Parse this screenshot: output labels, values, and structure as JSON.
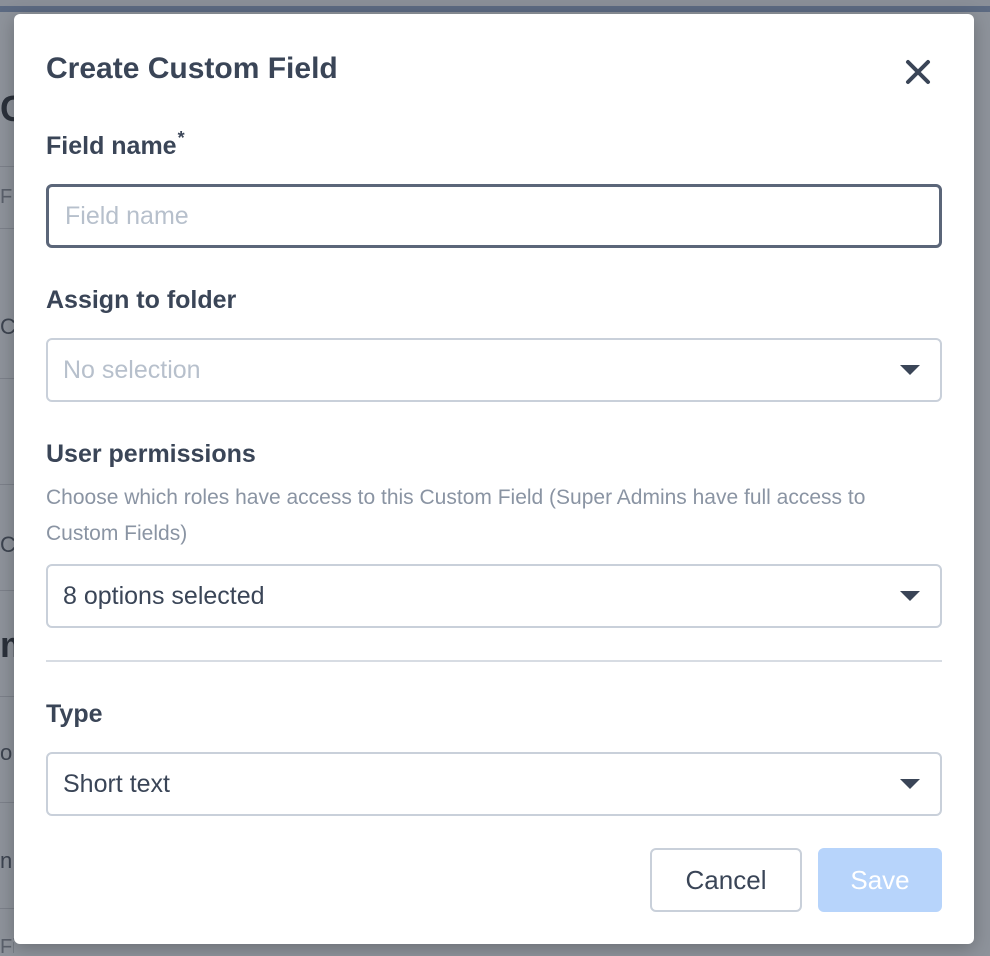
{
  "background": {
    "fragments": [
      "C",
      "F",
      "Cu",
      "Cu",
      "m",
      "o",
      "n",
      "Field"
    ]
  },
  "modal": {
    "title": "Create Custom Field",
    "close_icon": "close-icon",
    "field_name": {
      "label": "Field name",
      "required_mark": "*",
      "placeholder": "Field name",
      "value": ""
    },
    "folder": {
      "label": "Assign to folder",
      "value": "No selection"
    },
    "permissions": {
      "label": "User permissions",
      "help": "Choose which roles have access to this Custom Field (Super Admins have full access to Custom Fields)",
      "value": "8 options selected"
    },
    "type": {
      "label": "Type",
      "value": "Short text"
    },
    "buttons": {
      "cancel": "Cancel",
      "save": "Save"
    }
  },
  "colors": {
    "text": "#3a4557",
    "placeholder": "#b7c0cc",
    "save_disabled": "#b7d4fb"
  }
}
